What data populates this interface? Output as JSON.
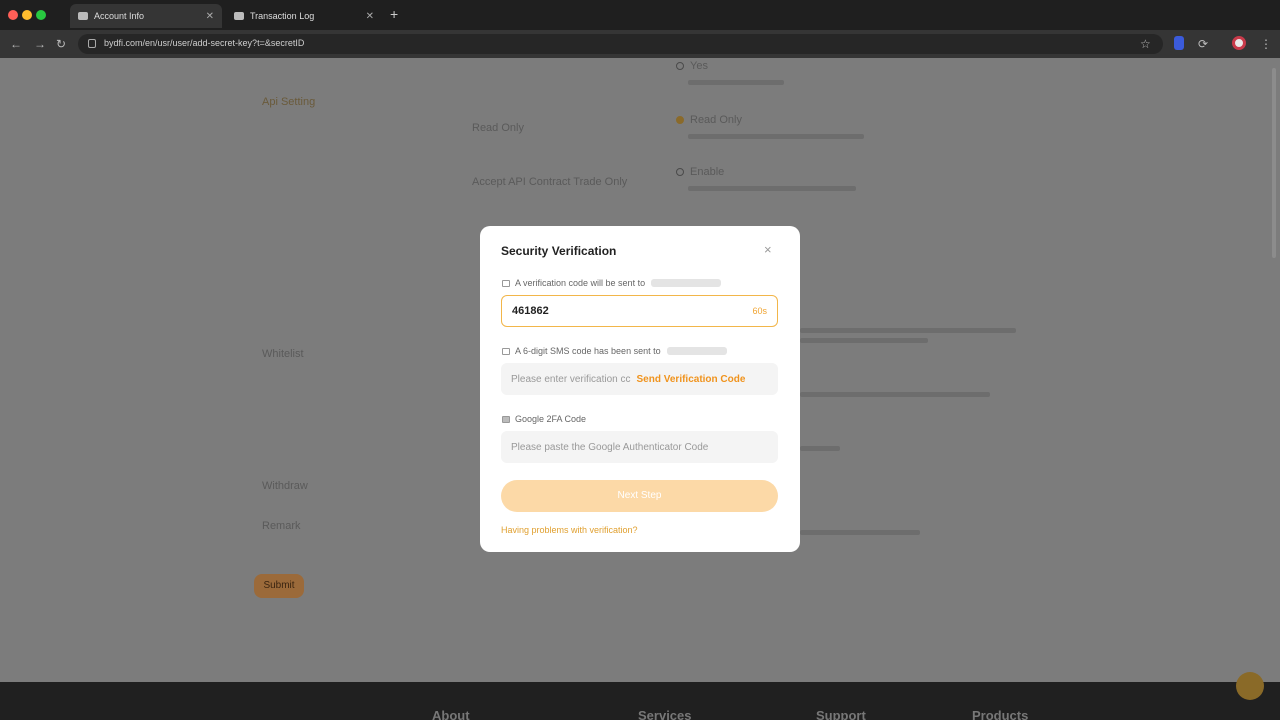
{
  "browser": {
    "tabs": [
      {
        "label": "Account Info"
      },
      {
        "label": "Transaction Log"
      }
    ],
    "new_tab": "+",
    "url": "bydfi.com/en/usr/user/add-secret-key?t=&secretID",
    "colors": {
      "close": "#ff5f57",
      "minimize": "#ffbd2e",
      "maximize": "#28c840",
      "brand": "#f0a431"
    }
  },
  "page": {
    "left_labels": [
      "Api Setting",
      "Whitelist",
      "Withdraw",
      "Remark"
    ],
    "mid_labels": [
      "Read Only",
      "Accept API Contract Trade Only"
    ],
    "options": [
      "Yes",
      "Read Only",
      "Enable"
    ],
    "submit": "Submit",
    "footer": [
      "About",
      "Services",
      "Support",
      "Products"
    ]
  },
  "modal": {
    "title": "Security Verification",
    "close": "×",
    "email_hint": "A verification code will be sent to",
    "email_code_value": "461862",
    "email_code_suffix": "60s",
    "sms_hint": "A 6-digit SMS code has been sent to",
    "sms_placeholder": "Please enter verification cc",
    "sms_link": "Send Verification Code",
    "ga_hint": "Google 2FA Code",
    "ga_placeholder": "Please paste the Google Authenticator Code",
    "submit": "Next Step",
    "footer_link": "Having problems with verification?"
  }
}
